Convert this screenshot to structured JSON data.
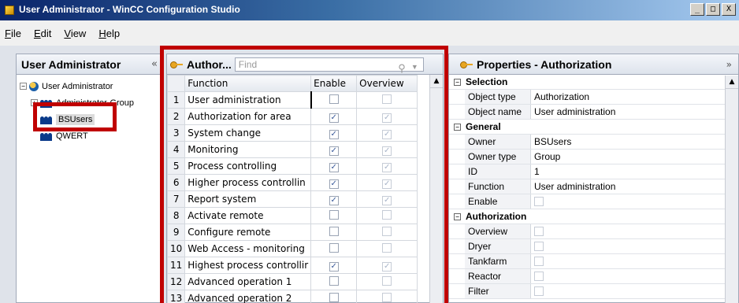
{
  "window": {
    "title": "User Administrator - WinCC Configuration Studio",
    "controls": [
      "_",
      "□",
      "X"
    ]
  },
  "menu": [
    "File",
    "Edit",
    "View",
    "Help"
  ],
  "left_panel": {
    "title": "User Administrator",
    "collapse": "«",
    "tree": {
      "root": "User Administrator",
      "groups": [
        "Administrator-Group",
        "BSUsers",
        "QWERT"
      ]
    }
  },
  "middle_panel": {
    "title": "Author...",
    "find_placeholder": "Find",
    "columns": [
      "Function",
      "Enable",
      "Overview"
    ],
    "rows": [
      {
        "n": "1",
        "fn": "User administration",
        "enable": false,
        "overview": false
      },
      {
        "n": "2",
        "fn": "Authorization for area",
        "enable": true,
        "overview": true
      },
      {
        "n": "3",
        "fn": "System change",
        "enable": true,
        "overview": true
      },
      {
        "n": "4",
        "fn": "Monitoring",
        "enable": true,
        "overview": true
      },
      {
        "n": "5",
        "fn": "Process controlling",
        "enable": true,
        "overview": true
      },
      {
        "n": "6",
        "fn": "Higher process controllin",
        "enable": true,
        "overview": true
      },
      {
        "n": "7",
        "fn": "Report system",
        "enable": true,
        "overview": true
      },
      {
        "n": "8",
        "fn": "Activate remote",
        "enable": false,
        "overview": false
      },
      {
        "n": "9",
        "fn": "Configure remote",
        "enable": false,
        "overview": false
      },
      {
        "n": "10",
        "fn": "Web Access - monitoring",
        "enable": false,
        "overview": false
      },
      {
        "n": "11",
        "fn": "Highest process controllir",
        "enable": true,
        "overview": true
      },
      {
        "n": "12",
        "fn": "Advanced operation 1",
        "enable": false,
        "overview": false
      },
      {
        "n": "13",
        "fn": "Advanced operation 2",
        "enable": false,
        "overview": false
      }
    ]
  },
  "right_panel": {
    "title": "Properties - Authorization",
    "expand": "»",
    "sections": {
      "selection": "Selection",
      "general": "General",
      "authorization": "Authorization"
    },
    "selection": [
      {
        "k": "Object type",
        "v": "Authorization"
      },
      {
        "k": "Object name",
        "v": "User administration"
      }
    ],
    "general": [
      {
        "k": "Owner",
        "v": "BSUsers"
      },
      {
        "k": "Owner type",
        "v": "Group"
      },
      {
        "k": "ID",
        "v": "1"
      },
      {
        "k": "Function",
        "v": "User administration"
      },
      {
        "k": "Enable",
        "v": ""
      }
    ],
    "authorization": [
      "Overview",
      "Dryer",
      "Tankfarm",
      "Reactor",
      "Filter"
    ]
  },
  "colors": {
    "highlight": "#c00000",
    "title_bar": "#0a246a"
  }
}
